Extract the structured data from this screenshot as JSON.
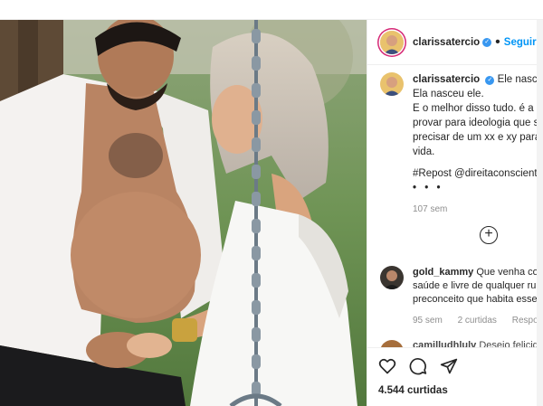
{
  "post": {
    "username": "clarissatercio",
    "follow_label": "Seguir",
    "separator": "•"
  },
  "caption": {
    "lines": [
      "Ele nasceu e",
      "Ela nasceu ele.",
      "E o melhor disso tudo. é a bi",
      "provar para ideologia que se",
      "precisar de um xx e xy para g",
      "vida."
    ],
    "hashtag": "#Repost @direitaconsciente",
    "more_dots": "• • •",
    "time": "107 sem"
  },
  "comments": [
    {
      "username": "gold_kammy",
      "lines": [
        "Que venha cor",
        "saúde e livre de qualquer rui",
        "preconceito que habita esse"
      ],
      "time": "95 sem",
      "likes": "2 curtidas",
      "reply_label": "Responder"
    },
    {
      "username": "camilludhlulv",
      "text": "Desejo felicidad"
    }
  ],
  "actions": {
    "likes_count": "4.544 curtidas"
  },
  "icons": {
    "verified": "verified-badge-icon",
    "load_more": "plus-circle-icon",
    "like": "heart-icon",
    "comment": "comment-icon",
    "share": "share-icon"
  },
  "colors": {
    "link": "#0095f6",
    "verified": "#3897f0",
    "hashtag": "#00376b",
    "muted": "#8e8e8e"
  }
}
